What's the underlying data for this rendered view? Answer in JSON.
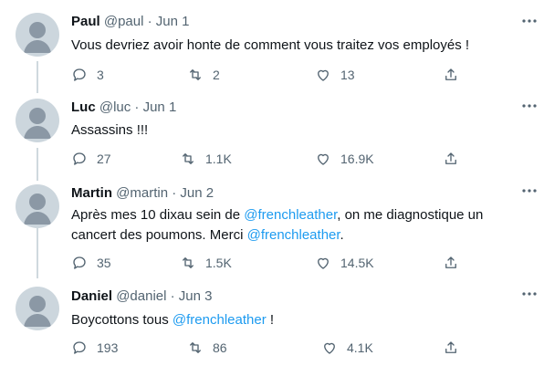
{
  "tweets": [
    {
      "name": "Paul",
      "handle": "@paul",
      "sep": "·",
      "date": "Jun 1",
      "text_plain": "Vous devriez avoir honte de comment vous traitez vos employés !",
      "replies": "3",
      "retweets": "2",
      "likes": "13"
    },
    {
      "name": "Luc",
      "handle": "@luc",
      "sep": "·",
      "date": "Jun 1",
      "text_plain": "Assassins !!!",
      "replies": "27",
      "retweets": "1.1K",
      "likes": "16.9K"
    },
    {
      "name": "Martin",
      "handle": "@martin",
      "sep": "·",
      "date": "Jun 2",
      "text_parts": [
        "Après mes 10 dixau sein de ",
        "@frenchleather",
        ", on me diagnostique un",
        "cancert des poumons. Merci ",
        "@frenchleather",
        "."
      ],
      "replies": "35",
      "retweets": "1.5K",
      "likes": "14.5K"
    },
    {
      "name": "Daniel",
      "handle": "@daniel",
      "sep": "·",
      "date": "Jun 3",
      "text_parts": [
        "Boycottons tous ",
        "@frenchleather",
        " !"
      ],
      "replies": "193",
      "retweets": "86",
      "likes": "4.1K"
    }
  ],
  "icons": {
    "reply": "reply-icon",
    "retweet": "retweet-icon",
    "like": "like-icon",
    "share": "share-icon",
    "more": "more-icon",
    "avatar": "default-avatar-icon"
  },
  "colors": {
    "mention": "#1d9bf0",
    "secondary": "#536471",
    "avatar": "#ccd6dd",
    "thread_line": "#cfd9de"
  }
}
